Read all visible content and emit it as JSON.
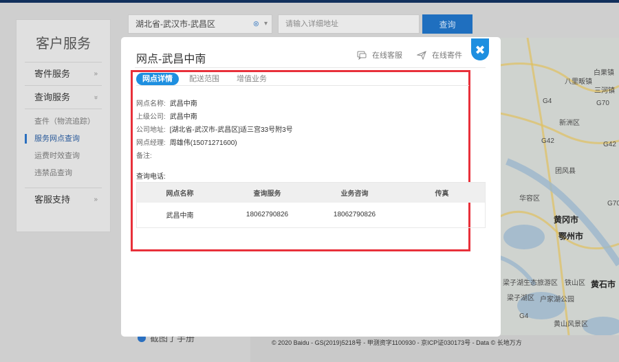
{
  "search": {
    "region": "湖北省-武汉市-武昌区",
    "detail_placeholder": "请输入详细地址",
    "button": "查询"
  },
  "sidebar": {
    "title": "客户服务",
    "groups": [
      {
        "label": "寄件服务",
        "chevron": "»"
      },
      {
        "label": "查询服务",
        "chevron": "»"
      },
      {
        "label": "客服支持",
        "chevron": "»"
      }
    ],
    "sub_items": [
      {
        "label": "查件（物流追踪）"
      },
      {
        "label": "服务网点查询"
      },
      {
        "label": "运费时效查询"
      },
      {
        "label": "违禁品查询"
      }
    ]
  },
  "help_link": "截图了手册",
  "map": {
    "labels": [
      "白果镇",
      "八里畈镇",
      "三河镇",
      "新洲区",
      "团风县",
      "华容区",
      "黄冈市",
      "鄂州市",
      "梁子湖生态旅游区",
      "铁山区",
      "黄石市",
      "梁子湖区",
      "户家湖公园",
      "黄山风景区"
    ],
    "road_labels": [
      "G4",
      "G70",
      "G42",
      "G42",
      "G70",
      "G4"
    ],
    "copyright": "© 2020 Baidu - GS(2019)5218号 - 甲测资字1100930 - 京ICP证030173号 - Data © 长地万方"
  },
  "modal": {
    "title": "网点-武昌中南",
    "actions": {
      "online_service": "在线客服",
      "online_send": "在线寄件"
    },
    "close": "✖",
    "tabs": [
      "网点详情",
      "配送范围",
      "增值业务"
    ],
    "details": [
      {
        "label": "网点名称:",
        "value": "武昌中南"
      },
      {
        "label": "上级公司:",
        "value": "武昌中南"
      },
      {
        "label": "公司地址:",
        "value": "[湖北省-武汉市-武昌区]适三宫33号附3号"
      },
      {
        "label": "网点经理:",
        "value": "周雄伟(15071271600)"
      },
      {
        "label": "备注:",
        "value": ""
      }
    ],
    "contact_title": "查询电话:",
    "table": {
      "headers": [
        "网点名称",
        "查询服务",
        "业务咨询",
        "传真"
      ],
      "rows": [
        [
          "武昌中南",
          "18062790826",
          "18062790826",
          ""
        ]
      ]
    }
  },
  "colors": {
    "accent": "#1e8fe0",
    "highlight": "#e8303a",
    "topbar": "#12305c"
  }
}
